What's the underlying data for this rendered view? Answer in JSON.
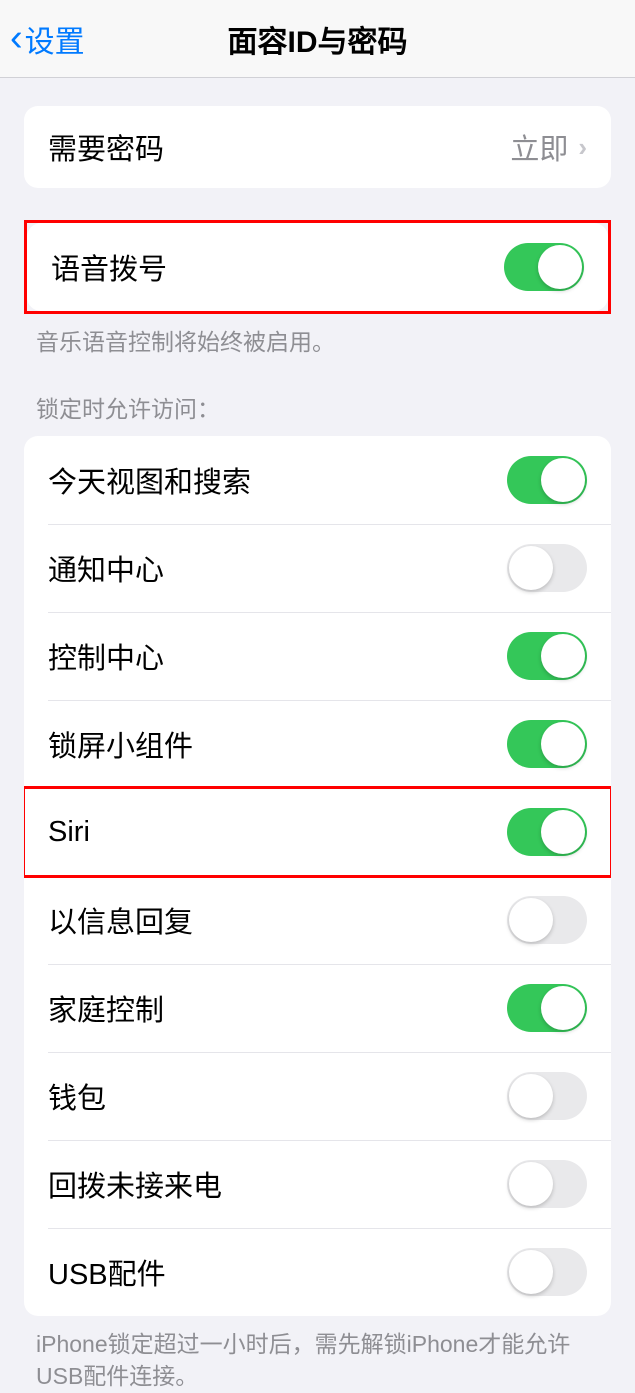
{
  "header": {
    "back_label": "设置",
    "title": "面容ID与密码"
  },
  "require_passcode": {
    "label": "需要密码",
    "value": "立即"
  },
  "voice_dial": {
    "label": "语音拨号",
    "enabled": true,
    "footer": "音乐语音控制将始终被启用。"
  },
  "lock_access": {
    "header": "锁定时允许访问：",
    "items": [
      {
        "label": "今天视图和搜索",
        "enabled": true
      },
      {
        "label": "通知中心",
        "enabled": false
      },
      {
        "label": "控制中心",
        "enabled": true
      },
      {
        "label": "锁屏小组件",
        "enabled": true
      },
      {
        "label": "Siri",
        "enabled": true
      },
      {
        "label": "以信息回复",
        "enabled": false
      },
      {
        "label": "家庭控制",
        "enabled": true
      },
      {
        "label": "钱包",
        "enabled": false
      },
      {
        "label": "回拨未接来电",
        "enabled": false
      },
      {
        "label": "USB配件",
        "enabled": false
      }
    ],
    "footer": "iPhone锁定超过一小时后，需先解锁iPhone才能允许USB配件连接。"
  }
}
